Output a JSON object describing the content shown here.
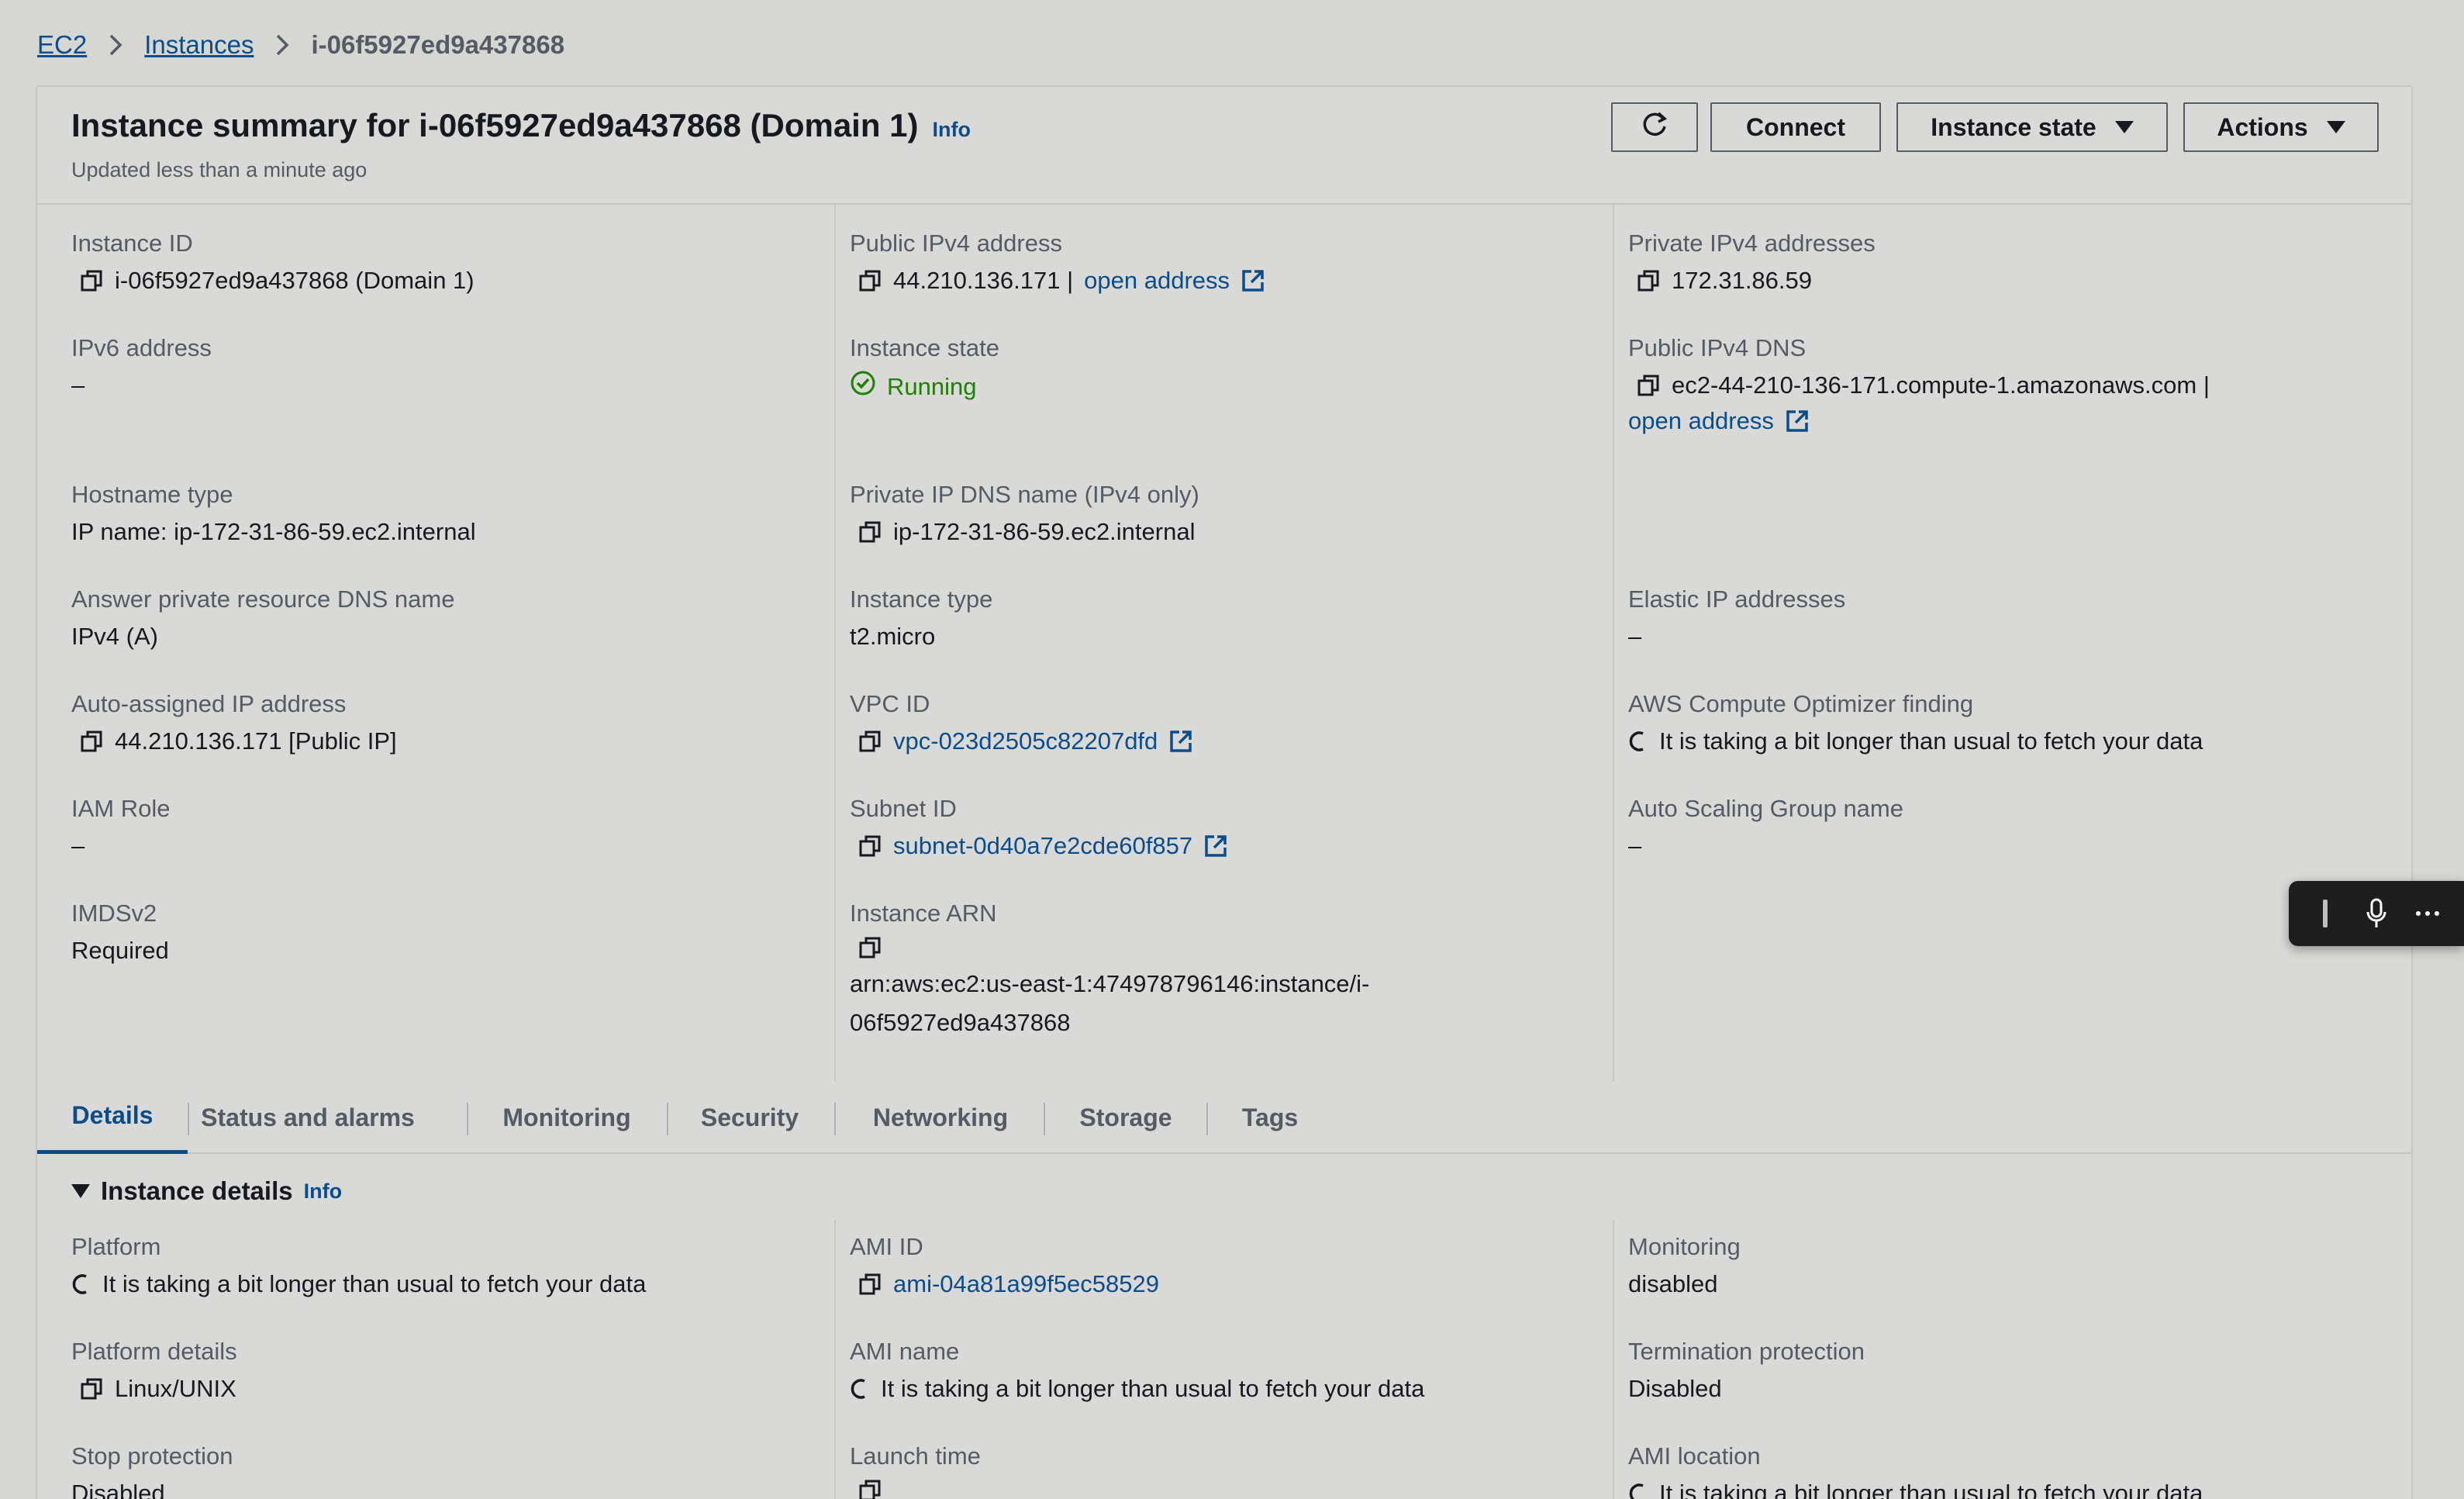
{
  "breadcrumb": {
    "items": [
      "EC2",
      "Instances"
    ],
    "current": "i-06f5927ed9a437868"
  },
  "header": {
    "title": "Instance summary for i-06f5927ed9a437868 (Domain 1)",
    "info": "Info",
    "subtitle": "Updated less than a minute ago",
    "buttons": {
      "connect": "Connect",
      "instance_state": "Instance state",
      "actions": "Actions"
    }
  },
  "summary": {
    "instance_id": {
      "label": "Instance ID",
      "value": "i-06f5927ed9a437868 (Domain 1)"
    },
    "public_ipv4": {
      "label": "Public IPv4 address",
      "value": "44.210.136.171 |",
      "link": "open address"
    },
    "private_ipv4": {
      "label": "Private IPv4 addresses",
      "value": "172.31.86.59"
    },
    "ipv6": {
      "label": "IPv6 address",
      "value": "–"
    },
    "instance_state": {
      "label": "Instance state",
      "value": "Running"
    },
    "public_dns": {
      "label": "Public IPv4 DNS",
      "value": "ec2-44-210-136-171.compute-1.amazonaws.com |",
      "link": "open address"
    },
    "hostname_type": {
      "label": "Hostname type",
      "value": "IP name: ip-172-31-86-59.ec2.internal"
    },
    "private_dns": {
      "label": "Private IP DNS name (IPv4 only)",
      "value": "ip-172-31-86-59.ec2.internal"
    },
    "answer_dns": {
      "label": "Answer private resource DNS name",
      "value": "IPv4 (A)"
    },
    "instance_type": {
      "label": "Instance type",
      "value": "t2.micro"
    },
    "elastic_ip": {
      "label": "Elastic IP addresses",
      "value": "–"
    },
    "auto_ip": {
      "label": "Auto-assigned IP address",
      "value": "44.210.136.171 [Public IP]"
    },
    "vpc_id": {
      "label": "VPC ID",
      "value": "vpc-023d2505c82207dfd"
    },
    "optimizer": {
      "label": "AWS Compute Optimizer finding",
      "value": "It is taking a bit longer than usual to fetch your data"
    },
    "iam_role": {
      "label": "IAM Role",
      "value": "–"
    },
    "subnet_id": {
      "label": "Subnet ID",
      "value": "subnet-0d40a7e2cde60f857"
    },
    "asg": {
      "label": "Auto Scaling Group name",
      "value": "–"
    },
    "imdsv2": {
      "label": "IMDSv2",
      "value": "Required"
    },
    "arn": {
      "label": "Instance ARN",
      "line1": "arn:aws:ec2:us-east-1:474978796146:instance/i-",
      "line2": "06f5927ed9a437868"
    }
  },
  "tabs": [
    "Details",
    "Status and alarms",
    "Monitoring",
    "Security",
    "Networking",
    "Storage",
    "Tags"
  ],
  "details": {
    "heading": "Instance details",
    "info": "Info",
    "platform": {
      "label": "Platform",
      "value": "It is taking a bit longer than usual to fetch your data"
    },
    "ami_id": {
      "label": "AMI ID",
      "value": "ami-04a81a99f5ec58529"
    },
    "monitoring": {
      "label": "Monitoring",
      "value": "disabled"
    },
    "platform_details": {
      "label": "Platform details",
      "value": "Linux/UNIX"
    },
    "ami_name": {
      "label": "AMI name",
      "value": "It is taking a bit longer than usual to fetch your data"
    },
    "termination": {
      "label": "Termination protection",
      "value": "Disabled"
    },
    "stop_protection": {
      "label": "Stop protection",
      "value": "Disabled"
    },
    "launch_time": {
      "label": "Launch time"
    },
    "ami_location": {
      "label": "AMI location",
      "value": "It is taking a bit longer than usual to fetch your data"
    }
  },
  "colors": {
    "link": "#0b4c8a",
    "running": "#1d8102",
    "background": "#d6d6d3"
  }
}
